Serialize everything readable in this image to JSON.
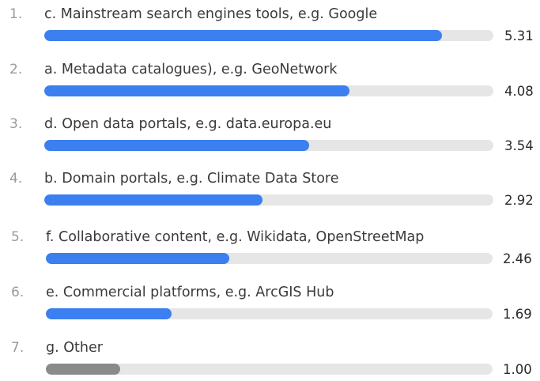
{
  "chart_data": {
    "type": "bar",
    "orientation": "horizontal",
    "scale_max": 6,
    "colors": {
      "bar": "#3b7ff0",
      "bar_other": "#8a8a8a",
      "track": "#e6e6e6"
    },
    "items": [
      {
        "rank": "1.",
        "label": "c. Mainstream search engines tools, e.g. Google",
        "value": 5.31,
        "display": "5.31"
      },
      {
        "rank": "2.",
        "label": "a. Metadata catalogues), e.g. GeoNetwork",
        "value": 4.08,
        "display": "4.08"
      },
      {
        "rank": "3.",
        "label": "d. Open data portals, e.g. data.europa.eu",
        "value": 3.54,
        "display": "3.54"
      },
      {
        "rank": "4.",
        "label": "b. Domain portals, e.g. Climate Data Store",
        "value": 2.92,
        "display": "2.92"
      },
      {
        "rank": "5.",
        "label": "f. Collaborative content, e.g. Wikidata, OpenStreetMap",
        "value": 2.46,
        "display": "2.46"
      },
      {
        "rank": "6.",
        "label": "e. Commercial platforms, e.g. ArcGIS Hub",
        "value": 1.69,
        "display": "1.69"
      },
      {
        "rank": "7.",
        "label": "g. Other",
        "value": 1.0,
        "display": "1.00",
        "muted": true
      }
    ]
  }
}
